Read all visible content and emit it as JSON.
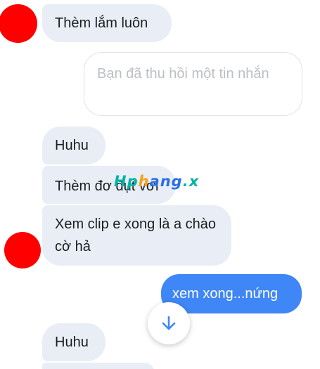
{
  "messages": [
    {
      "id": "m1",
      "direction": "received",
      "text": "Thèm lắm luôn"
    },
    {
      "id": "m2",
      "direction": "sent",
      "recalled": true,
      "text": "Bạn đã thu hồi một tin nhắn"
    },
    {
      "id": "m3",
      "direction": "received",
      "text": "Huhu"
    },
    {
      "id": "m4",
      "direction": "received",
      "text": "Thèm đơ đụt vơi"
    },
    {
      "id": "m5",
      "direction": "received",
      "text": "Xem clip e xong là a chào cờ hả"
    },
    {
      "id": "m6",
      "direction": "sent",
      "text": "xem xong...nứng"
    },
    {
      "id": "m7",
      "direction": "received",
      "text": "Huhu"
    }
  ],
  "watermark": {
    "part_a": "Hp",
    "part_b": "h",
    "part_c": "ang",
    "part_d": ".x"
  },
  "scroll_button": {
    "icon": "arrow-down-icon"
  },
  "colors": {
    "received_bubble": "#e9edf5",
    "sent_bubble": "#3f86f6",
    "avatar": "#fe0000",
    "recalled_text": "#bcc0c6"
  }
}
